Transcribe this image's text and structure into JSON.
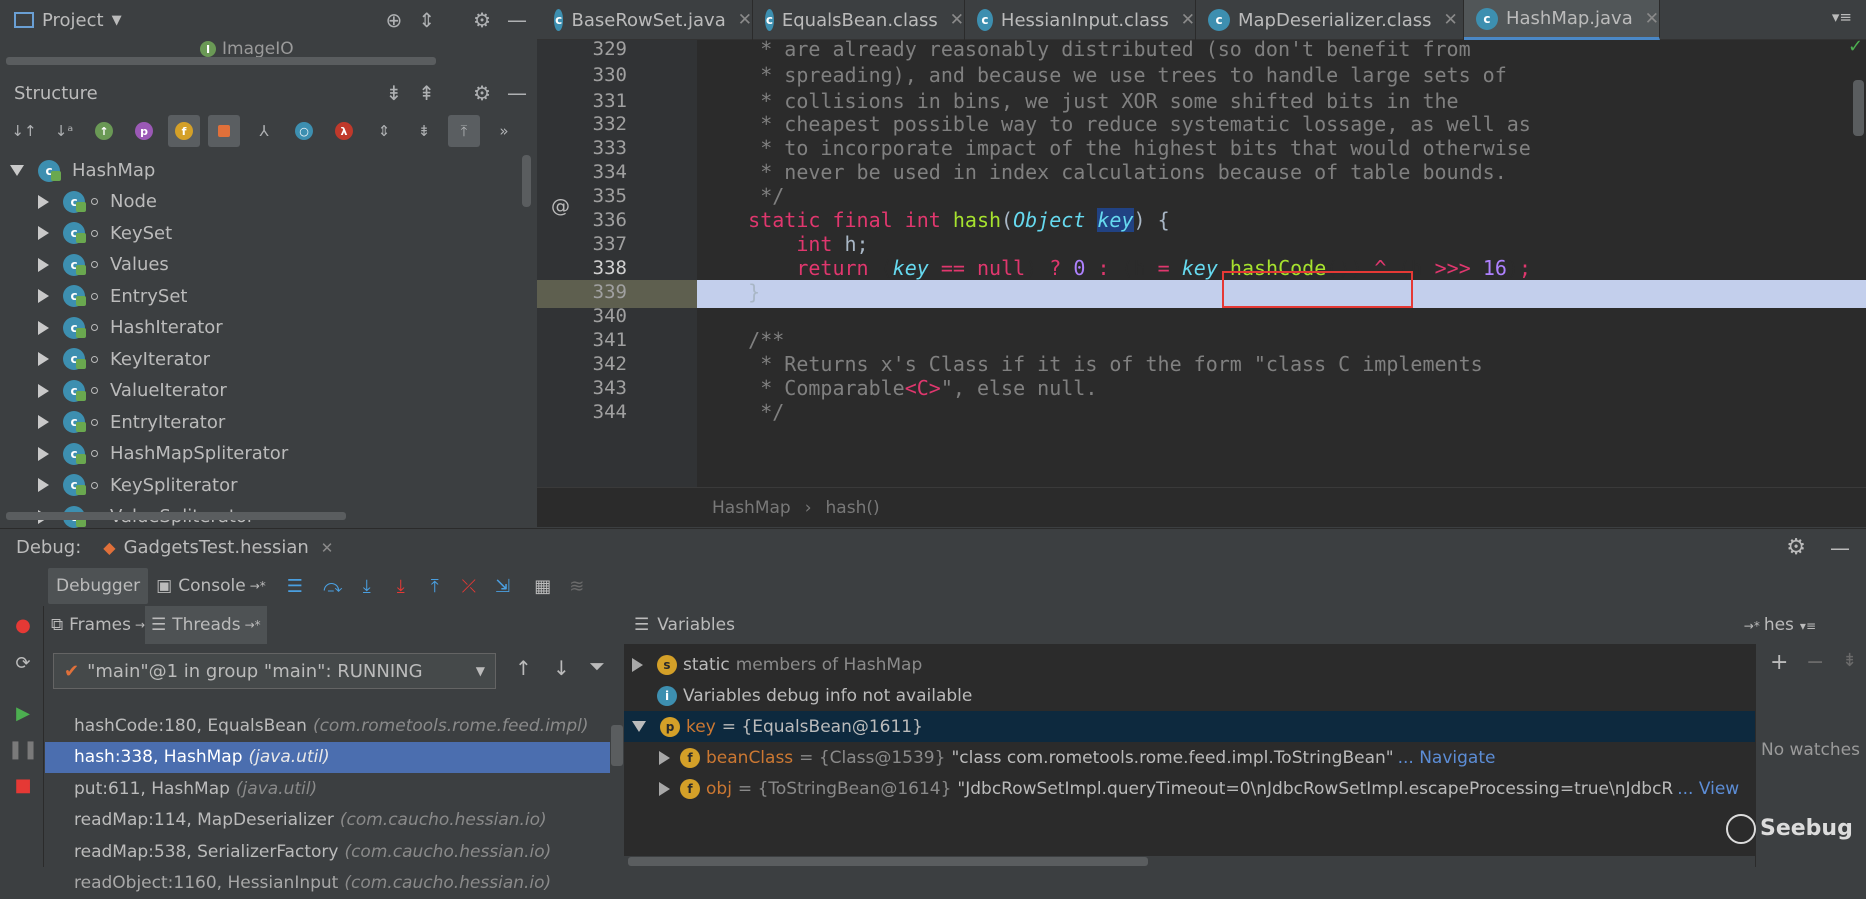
{
  "project_panel": {
    "title": "Project",
    "module": "ImageIO"
  },
  "structure_panel": {
    "title": "Structure",
    "root": "HashMap",
    "items": [
      "Node",
      "KeySet",
      "Values",
      "EntrySet",
      "HashIterator",
      "KeyIterator",
      "ValueIterator",
      "EntryIterator",
      "HashMapSpliterator",
      "KeySpliterator",
      "ValueSpliterator"
    ]
  },
  "editor_tabs": [
    {
      "label": "BaseRowSet.java",
      "active": false
    },
    {
      "label": "EqualsBean.class",
      "active": false
    },
    {
      "label": "HessianInput.class",
      "active": false
    },
    {
      "label": "MapDeserializer.class",
      "active": false
    },
    {
      "label": "HashMap.java",
      "active": true
    }
  ],
  "editor": {
    "line_numbers": [
      "329",
      "330",
      "331",
      "332",
      "333",
      "334",
      "335",
      "336",
      "337",
      "338",
      "339",
      "340",
      "341",
      "342",
      "343",
      "344"
    ],
    "current_line": "338",
    "gutter_annotation": "@",
    "breadcrumb": [
      "HashMap",
      "hash()"
    ]
  },
  "debug": {
    "label": "Debug:",
    "session": "GadgetsTest.hessian",
    "tabs": [
      "Debugger",
      "Console"
    ],
    "frames_tab": "Frames",
    "threads_tab": "Threads",
    "thread_selected": "\"main\"@1 in group \"main\": RUNNING",
    "frames": [
      {
        "method": "hashCode:180, EqualsBean",
        "pkg": "(com.rometools.rome.feed.impl)"
      },
      {
        "method": "hash:338, HashMap",
        "pkg": "(java.util)"
      },
      {
        "method": "put:611, HashMap",
        "pkg": "(java.util)"
      },
      {
        "method": "readMap:114, MapDeserializer",
        "pkg": "(com.caucho.hessian.io)"
      },
      {
        "method": "readMap:538, SerializerFactory",
        "pkg": "(com.caucho.hessian.io)"
      },
      {
        "method": "readObject:1160, HessianInput",
        "pkg": "(com.caucho.hessian.io)"
      }
    ],
    "variables_title": "Variables",
    "variables_right": "hes",
    "var_static": {
      "label": "static",
      "rest": "members of HashMap"
    },
    "var_info": "Variables debug info not available",
    "var_key": {
      "name": "key",
      "value": "= {EqualsBean@1611}"
    },
    "var_beanClass": {
      "name": "beanClass",
      "type": "= {Class@1539}",
      "value": "\"class com.rometools.rome.feed.impl.ToStringBean\"",
      "link": "... Navigate"
    },
    "var_obj": {
      "name": "obj",
      "type": "= {ToStringBean@1614}",
      "value": "\"JdbcRowSetImpl.queryTimeout=0\\nJdbcRowSetImpl.escapeProcessing=true\\nJdbcR",
      "link": "... View"
    },
    "watches_empty": "No watches"
  },
  "watermark": "Seebug",
  "colors": {
    "selection": "#4b6eaf",
    "accent": "#4a88c7",
    "highlight_line": "#c3cfec",
    "red_box": "#e53935"
  }
}
